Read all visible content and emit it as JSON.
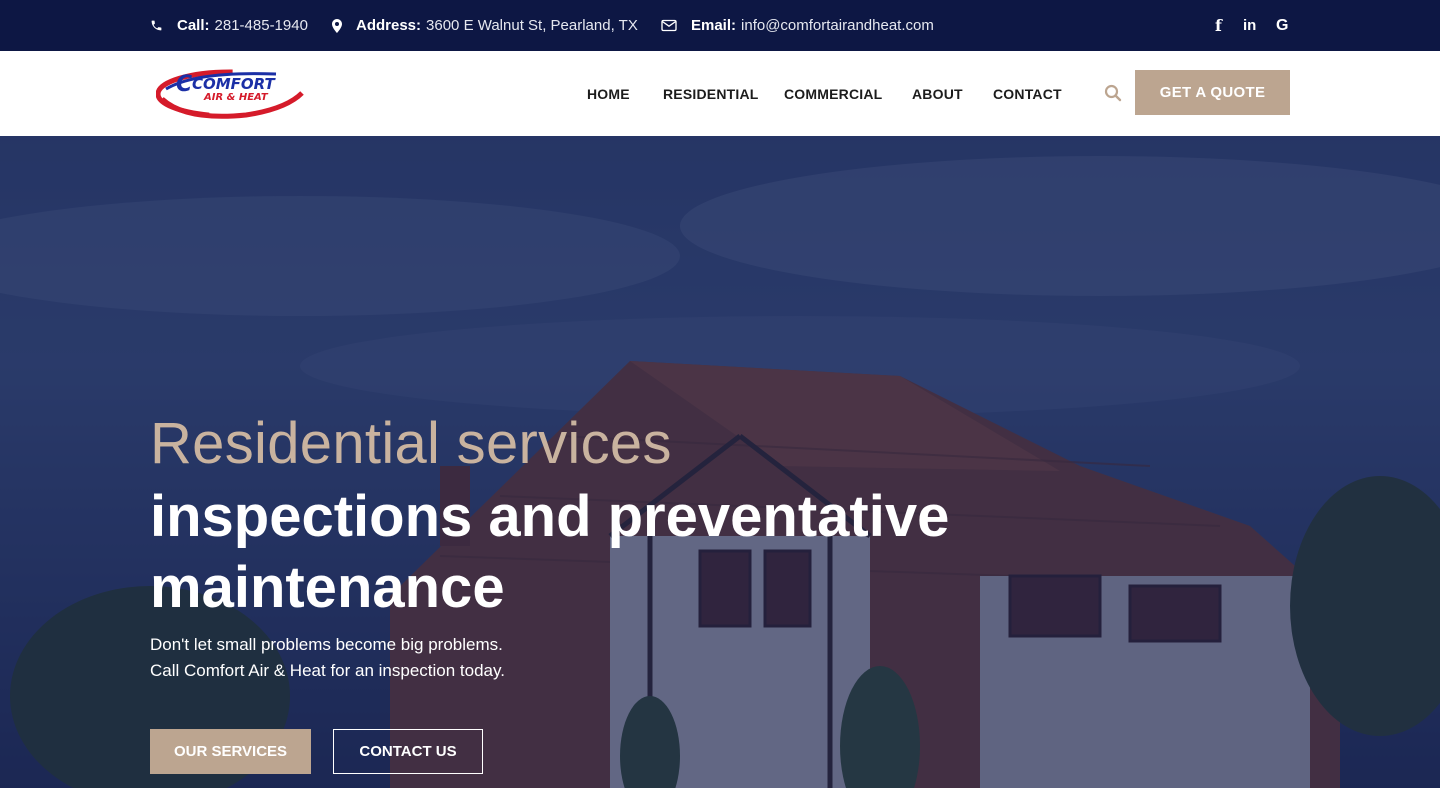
{
  "topbar": {
    "call_label": "Call:",
    "call_value": "281-485-1940",
    "address_label": "Address:",
    "address_value": "3600 E Walnut St, Pearland, TX",
    "email_label": "Email:",
    "email_value": "info@comfortairandheat.com",
    "social": {
      "facebook": "f",
      "linkedin": "in",
      "google": "G"
    }
  },
  "logo": {
    "line1": "COMFORT",
    "line2": "AIR & HEAT"
  },
  "nav": {
    "items": [
      {
        "label": "HOME"
      },
      {
        "label": "RESIDENTIAL"
      },
      {
        "label": "COMMERCIAL"
      },
      {
        "label": "ABOUT"
      },
      {
        "label": "CONTACT"
      }
    ],
    "quote_button": "GET A QUOTE"
  },
  "hero": {
    "subtitle": "Residential services",
    "title": "inspections and preventative maintenance",
    "text_line1": "Don't let small problems become big problems.",
    "text_line2": "Call Comfort Air & Heat for an inspection today.",
    "primary_button": "OUR SERVICES",
    "secondary_button": "CONTACT US"
  },
  "colors": {
    "topbar_bg": "#0d1744",
    "accent": "#bca590",
    "logo_blue": "#1b2fa6",
    "logo_red": "#d51b2a"
  },
  "icons": {
    "phone": "phone-icon",
    "address": "map-marker-icon",
    "email": "envelope-icon",
    "search": "search-icon"
  }
}
